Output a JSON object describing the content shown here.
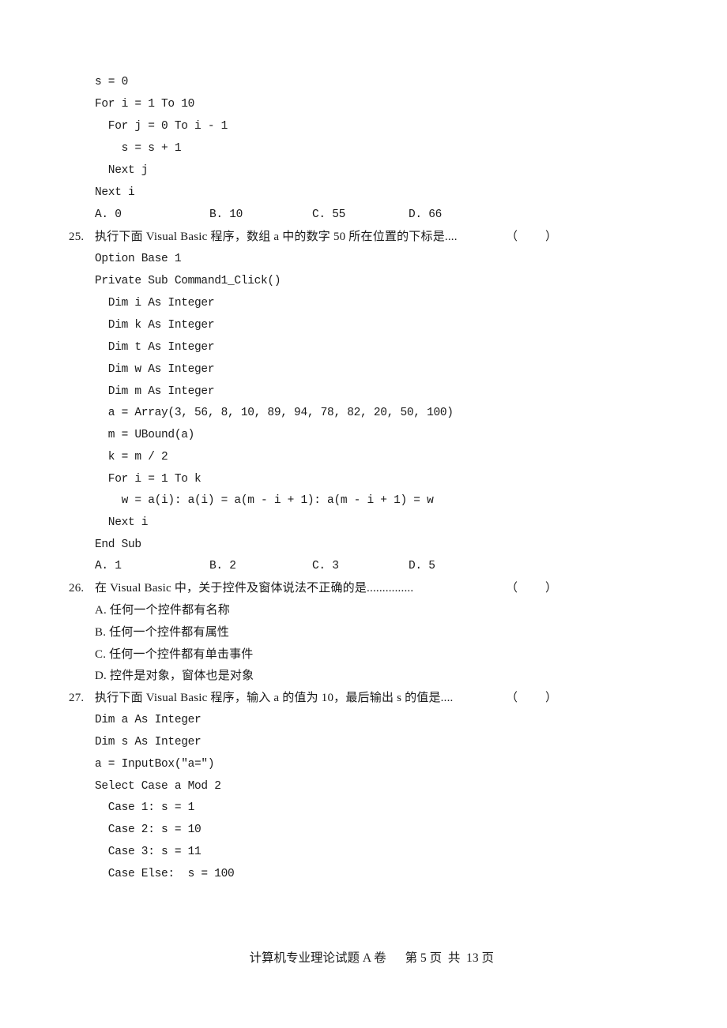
{
  "q24_tail": {
    "code": [
      "s = 0",
      "For i = 1 To 10",
      "  For j = 0 To i - 1",
      "    s = s + 1",
      "  Next j",
      "Next i"
    ],
    "options": [
      "A. 0",
      "B. 10",
      "C. 55",
      "D. 66"
    ]
  },
  "q25": {
    "number": "25.",
    "text": "执行下面 Visual Basic 程序，数组 a 中的数字 50 所在位置的下标是....",
    "paren_open": "（",
    "paren_close": "）",
    "code": [
      "Option Base 1",
      "Private Sub Command1_Click()",
      "  Dim i As Integer",
      "  Dim k As Integer",
      "  Dim t As Integer",
      "  Dim w As Integer",
      "  Dim m As Integer",
      "  a = Array(3, 56, 8, 10, 89, 94, 78, 82, 20, 50, 100)",
      "  m = UBound(a)",
      "  k = m / 2",
      "  For i = 1 To k",
      "    w = a(i): a(i) = a(m - i + 1): a(m - i + 1) = w",
      "  Next i",
      "End Sub"
    ],
    "options": [
      "A. 1",
      "B. 2",
      "C. 3",
      "D. 5"
    ]
  },
  "q26": {
    "number": "26.",
    "text": "在 Visual Basic 中，关于控件及窗体说法不正确的是...............",
    "paren_open": "（",
    "paren_close": "）",
    "options": [
      "A. 任何一个控件都有名称",
      "B. 任何一个控件都有属性",
      "C. 任何一个控件都有单击事件",
      "D. 控件是对象，窗体也是对象"
    ]
  },
  "q27": {
    "number": "27.",
    "text": "执行下面 Visual Basic 程序，输入 a 的值为 10，最后输出 s 的值是....",
    "paren_open": "（",
    "paren_close": "）",
    "code": [
      "Dim a As Integer",
      "Dim s As Integer",
      "a = InputBox(\"a=\")",
      "Select Case a Mod 2",
      "  Case 1: s = 1",
      "  Case 2: s = 10",
      "  Case 3: s = 11",
      "  Case Else:  s = 100"
    ]
  },
  "footer": {
    "title": "计算机专业理论试题 A 卷",
    "page_info": "第 5 页  共  13 页"
  }
}
